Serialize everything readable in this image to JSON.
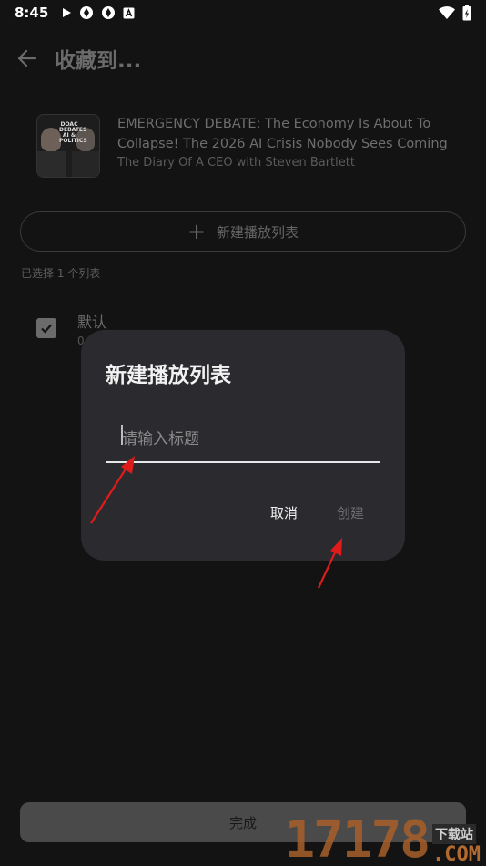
{
  "status_bar": {
    "time": "8:45"
  },
  "app_bar": {
    "title": "收藏到..."
  },
  "episode": {
    "title": "EMERGENCY DEBATE: The Economy Is About To Collapse! The 2026 AI Crisis Nobody Sees Coming",
    "podcast": "The Diary Of A CEO with Steven Bartlett",
    "thumbnail_text": "DOAC DEBATES AI & POLITICS"
  },
  "new_playlist_button": "新建播放列表",
  "selected_count": "已选择 1 个列表",
  "playlists": [
    {
      "name": "默认",
      "count": "0",
      "checked": true
    }
  ],
  "done_button": "完成",
  "dialog": {
    "title": "新建播放列表",
    "input_placeholder": "请输入标题",
    "input_value": "",
    "cancel": "取消",
    "create": "创建"
  },
  "watermark": {
    "digits": "17178",
    "cn": "下载站",
    "com": ".COM"
  },
  "colors": {
    "background": "#131313",
    "dialog": "#2b2a2f",
    "annotation_arrow": "#e01b1b"
  }
}
